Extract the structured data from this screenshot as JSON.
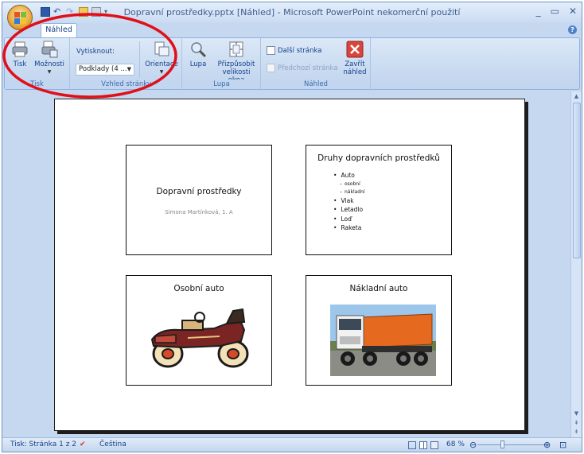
{
  "window": {
    "title": "Dopravní prostředky.pptx [Náhled] - Microsoft PowerPoint nekomerční použití",
    "controls": [
      "_",
      "▭",
      "✕"
    ]
  },
  "ribbon": {
    "active_tab": "Náhled",
    "groups": {
      "tisk": {
        "label": "Tisk",
        "print_button": "Tisk",
        "options_button": "Možnosti"
      },
      "vzhled": {
        "label": "Vzhled stránky",
        "print_what_label": "Vytisknout:",
        "print_what_value": "Podklady (4 ...",
        "orientation_button": "Orientace"
      },
      "lupa": {
        "label": "Lupa",
        "zoom_button": "Lupa",
        "fit_button_line1": "Přizpůsobit",
        "fit_button_line2": "velikosti okna"
      },
      "nahled": {
        "label": "Náhled",
        "next_page": "Další stránka",
        "prev_page": "Předchozí stránka",
        "close_line1": "Zavřít",
        "close_line2": "náhled"
      }
    }
  },
  "slides": [
    {
      "title": "Dopravní prostředky",
      "subtitle": "Simona Martínková, 1. A"
    },
    {
      "title": "Druhy dopravních prostředků",
      "bullets": [
        "Auto",
        "osobní",
        "nákladní",
        "Vlak",
        "Letadlo",
        "Loď",
        "Raketa"
      ]
    },
    {
      "title": "Osobní auto",
      "image": "vintage-car-clipart"
    },
    {
      "title": "Nákladní auto",
      "image": "dump-truck-photo"
    }
  ],
  "statusbar": {
    "page_info": "Tisk: Stránka 1 z 2",
    "language": "Čeština",
    "zoom": "68 %"
  },
  "colors": {
    "annotation": "#e0101a",
    "ribbon_text": "#15428b",
    "close_button": "#d9453a"
  }
}
